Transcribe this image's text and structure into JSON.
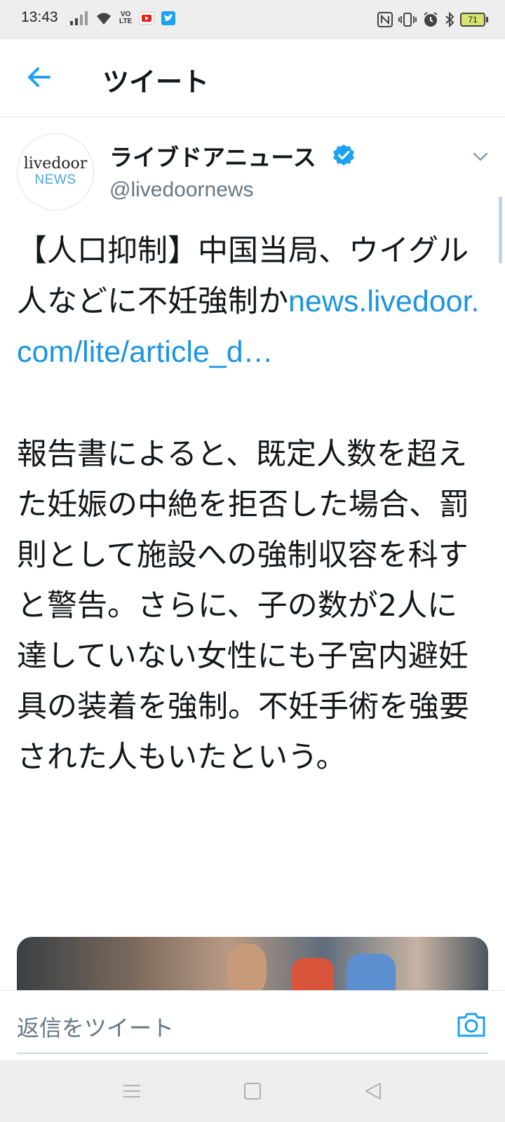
{
  "status_bar": {
    "time": "13:43",
    "volte_label_top": "VO",
    "volte_label_bottom": "LTE",
    "battery_level": "71",
    "icons": [
      "signal-icon",
      "wifi-icon",
      "volte-icon",
      "youtube-icon",
      "twitter-icon",
      "nfc-icon",
      "vibrate-icon",
      "alarm-icon",
      "bluetooth-icon",
      "battery-icon"
    ]
  },
  "header": {
    "title": "ツイート",
    "back_icon": "arrow-left-icon"
  },
  "tweet": {
    "avatar_line1": "livedoor",
    "avatar_line2": "NEWS",
    "author_name": "ライブドアニュース",
    "handle": "@livedoornews",
    "headline": "【人口抑制】中国当局、ウイグル人などに不妊強制か",
    "link": "news.livedoor.com/lite/article_d…",
    "body": "報告書によると、既定人数を超えた妊娠の中絶を拒否した場合、罰則として施設への強制収容を科すと警告。さらに、子の数が2人に達していない女性にも子宮内避妊具の装着を強制。不妊手術を強要された人もいたという。"
  },
  "reply": {
    "placeholder": "返信をツイート"
  },
  "colors": {
    "accent": "#1da1f2",
    "link": "#1b95e0",
    "secondary_text": "#657786"
  }
}
